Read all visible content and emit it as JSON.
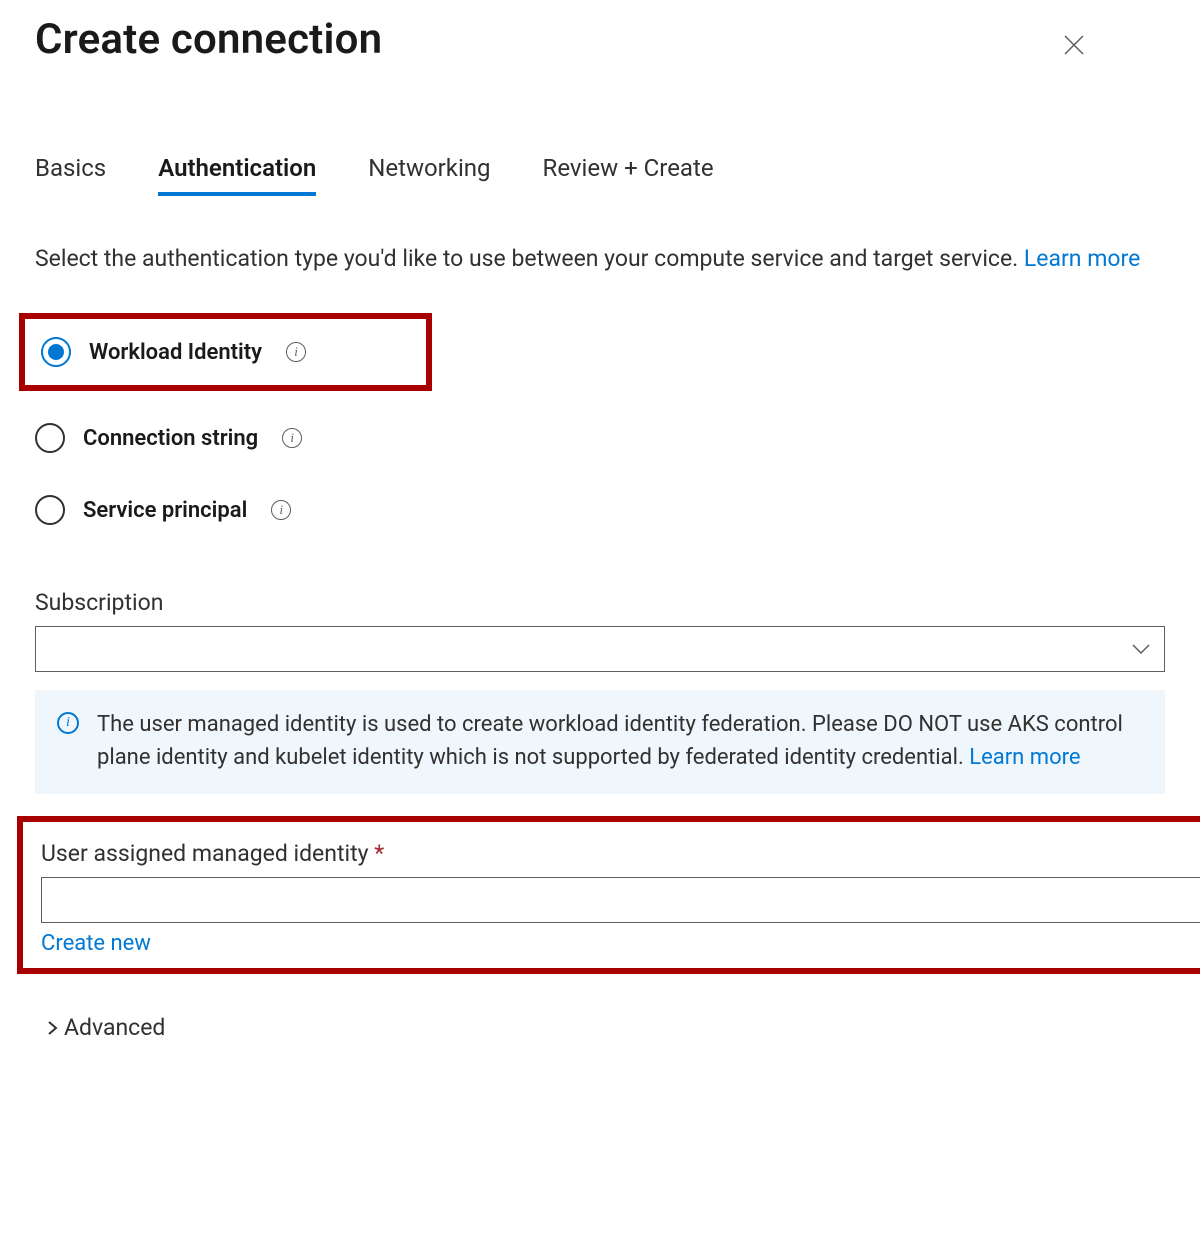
{
  "header": {
    "title": "Create connection"
  },
  "tabs": {
    "items": [
      {
        "label": "Basics",
        "active": false
      },
      {
        "label": "Authentication",
        "active": true
      },
      {
        "label": "Networking",
        "active": false
      },
      {
        "label": "Review + Create",
        "active": false
      }
    ]
  },
  "intro": {
    "text": "Select the authentication type you'd like to use between your compute service and target service. ",
    "learn_more": "Learn more"
  },
  "auth_options": {
    "items": [
      {
        "label": "Workload Identity",
        "selected": true,
        "highlighted": true
      },
      {
        "label": "Connection string",
        "selected": false,
        "highlighted": false
      },
      {
        "label": "Service principal",
        "selected": false,
        "highlighted": false
      }
    ]
  },
  "subscription": {
    "label": "Subscription",
    "value": ""
  },
  "info_banner": {
    "text": "The user managed identity is used to create workload identity federation. Please DO NOT use AKS control plane identity and kubelet identity which is not supported by federated identity credential. ",
    "learn_more": "Learn more"
  },
  "uami": {
    "label": "User assigned managed identity",
    "required_mark": "*",
    "value": "",
    "create_new": "Create new"
  },
  "advanced": {
    "label": "Advanced"
  }
}
